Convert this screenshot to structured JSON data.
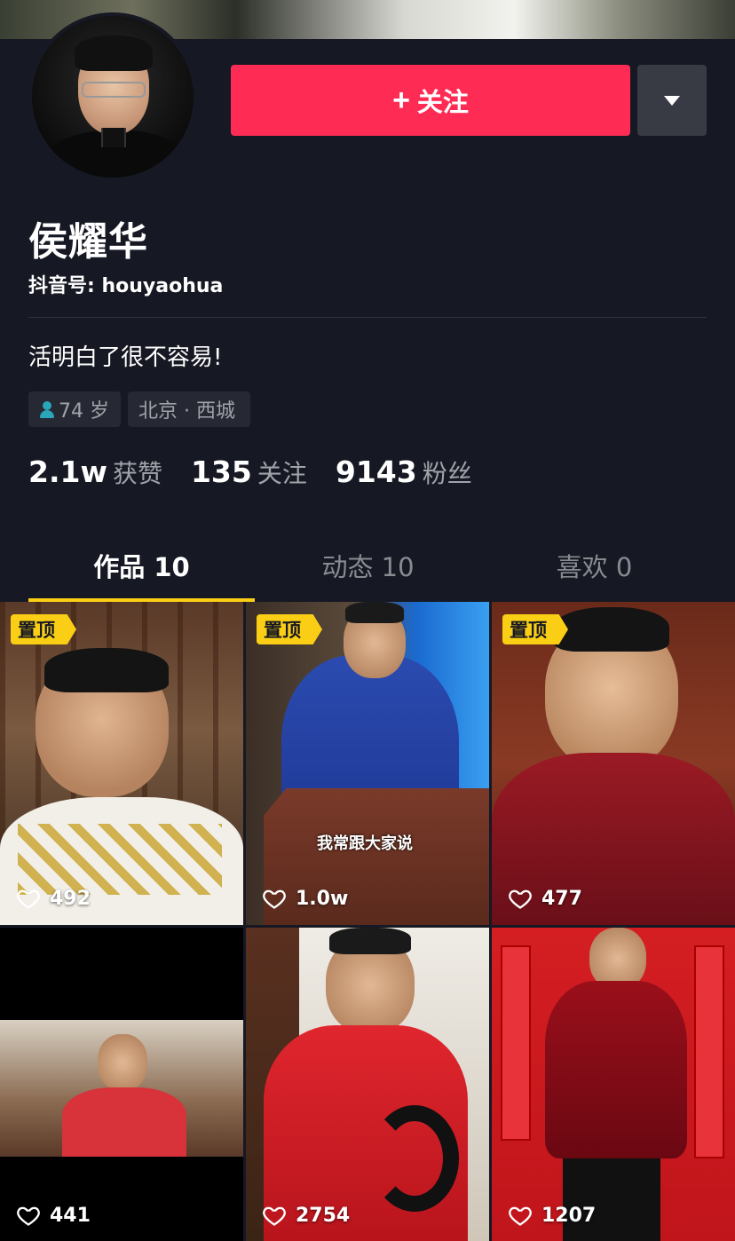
{
  "profile": {
    "name": "侯耀华",
    "handle": "抖音号: houyaohua",
    "bio": "活明白了很不容易!",
    "age": "74 岁",
    "location": "北京 · 西城",
    "follow_label": "关注",
    "follow_icon": "plus-icon",
    "more_icon": "caret-down-icon"
  },
  "stats": [
    {
      "value": "2.1w",
      "label": "获赞"
    },
    {
      "value": "135",
      "label": "关注"
    },
    {
      "value": "9143",
      "label": "粉丝"
    }
  ],
  "tabs": [
    {
      "label": "作品 10",
      "active": true
    },
    {
      "label": "动态 10",
      "active": false
    },
    {
      "label": "喜欢 0",
      "active": false
    }
  ],
  "videos": [
    {
      "pinned": true,
      "pin_label": "置顶",
      "likes": "492"
    },
    {
      "pinned": true,
      "pin_label": "置顶",
      "likes": "1.0w",
      "caption": "我常跟大家说"
    },
    {
      "pinned": true,
      "pin_label": "置顶",
      "likes": "477"
    },
    {
      "pinned": false,
      "likes": "441"
    },
    {
      "pinned": false,
      "likes": "2754"
    },
    {
      "pinned": false,
      "likes": "1207"
    }
  ],
  "colors": {
    "background": "#161823",
    "follow_button": "#fe2c55",
    "tab_indicator": "#face15",
    "pin_badge": "#face15",
    "muted_text": "#a1a3aa"
  }
}
